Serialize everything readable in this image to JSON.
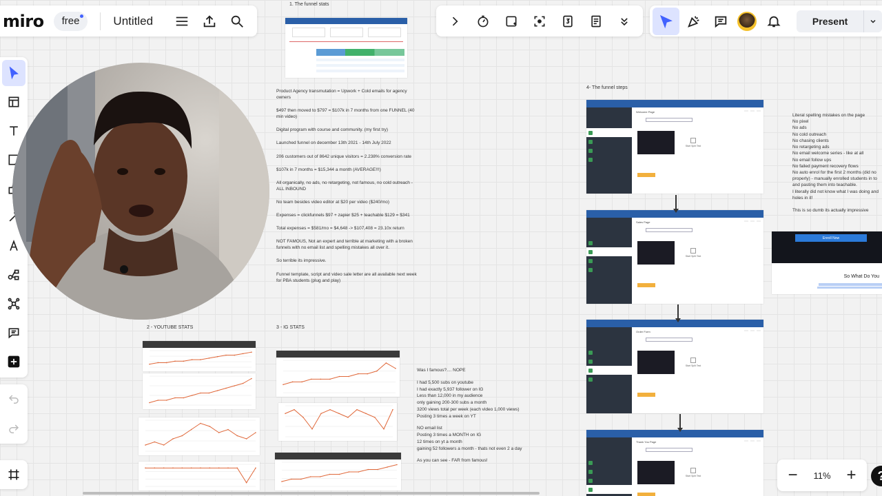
{
  "app": {
    "logo": "miro",
    "plan": "free",
    "board_title": "Untitled"
  },
  "topbar": {
    "present_label": "Present"
  },
  "zoom": {
    "level": "11%",
    "minus": "−",
    "plus": "+",
    "help": "?"
  },
  "sections": {
    "funnel_stats": "1. The funnel stats",
    "youtube_stats": "2 - YOUTUBE STATS",
    "ig_stats": "3 - IG STATS",
    "funnel_steps": "4- The funnel steps"
  },
  "notes": [
    "Product Agency transmutation = Upwork + Cold emails for agency owners",
    "$497 then moved to $797 = $107k in 7 months from one FUNNEL (40 min video)",
    "Digital program with course and community. (my first try)",
    "Launched funnel on december 13th 2021 - 14th July 2022",
    "206 customers out of 8642 unique visitors = 2.238% conversion rate",
    "$107k in 7 months = $15,344 a month (AVERAGE!!!)",
    "All organically, no ads, no retargeting, not famous, no cold outreach - ALL INBOUND",
    "No team besides video editor at $20 per video ($240/mo)",
    "Expenses = clickfunnels $97 + zapier $25 + teachable $129 = $341",
    "Total expenses = $581/mo = $4,648 -> $107,408 = 23.10x return",
    "NOT FAMOUS, Not an expert and terrible at marketing with a broken funnels with no email list and spelling mistakes all over it.",
    "So terrible its impressive.",
    "Funnel template, script and video sale letter are all available next week for PBA students (plug and play)"
  ],
  "fame_notes": {
    "intro": "Was I famous?.... NOPE",
    "youtube_lines": [
      "I had 5,500 subs on youtube",
      "I had exactly 5,937 follower on IG",
      "Less than 12,000 in my audience",
      "only gaining 200-300 subs a month",
      "3200 views total per week (each video 1,000 views)",
      "Posting 3 times a week on YT"
    ],
    "email_lines": [
      "NO email list",
      "Posting 3 times a MONTH on IG",
      "12 times on yt a month",
      "gaining 52 followers a month - thats not even 2 a day"
    ],
    "outro": "As you can see - FAR from famous!"
  },
  "mistakes": [
    "Literal spelling mistakes on the page",
    "No pixel",
    "No ads",
    "No cold outreach",
    "No chasing clients",
    "No retargeting ads",
    "No email welcome series - like at all",
    "No email follow ups",
    "No failed payment recovery flows",
    "No auto enrol for the first 2 months (did no",
    "properly) - manually enrolled students in to",
    "and pasting them into teachable.",
    "I literally did not know what I was doing and",
    "holes in it!",
    "",
    "This is so dumb its actually impressive"
  ],
  "webinar": {
    "enroll": "Enroll Now",
    "heading": "So What Do You"
  },
  "funnel_screens": [
    {
      "page": "Welcome Page",
      "start": "Start Split Test"
    },
    {
      "page": "Sales Page",
      "start": "Start Split Test"
    },
    {
      "page": "Order Form",
      "start": "Start Split Test"
    },
    {
      "page": "Thank You Page",
      "start": "Start Split Test"
    }
  ],
  "chart_data": [
    {
      "type": "line",
      "title": "",
      "series": [
        {
          "values": [
            2,
            3,
            3,
            4,
            4,
            5,
            5,
            6,
            7,
            8,
            8,
            9,
            10
          ]
        }
      ]
    },
    {
      "type": "line",
      "title": "",
      "series": [
        {
          "values": [
            1,
            2,
            2,
            3,
            3,
            4,
            5,
            5,
            6,
            7,
            8,
            9,
            11
          ]
        }
      ]
    },
    {
      "type": "line",
      "title": "",
      "series": [
        {
          "values": [
            2,
            3,
            2,
            4,
            5,
            7,
            9,
            8,
            6,
            7,
            5,
            4,
            6
          ]
        }
      ]
    },
    {
      "type": "line",
      "title": "",
      "series": [
        {
          "values": [
            5,
            5,
            5,
            5,
            5,
            5,
            5,
            5,
            5,
            5,
            5,
            1,
            5
          ]
        }
      ]
    },
    {
      "type": "line",
      "title": "",
      "series": [
        {
          "values": [
            3,
            4,
            4,
            5,
            5,
            5,
            6,
            6,
            7,
            7,
            8,
            11,
            9
          ]
        }
      ]
    },
    {
      "type": "line",
      "title": "",
      "series": [
        {
          "values": [
            6,
            7,
            5,
            2,
            6,
            7,
            6,
            5,
            7,
            6,
            5,
            2,
            7
          ]
        }
      ]
    },
    {
      "type": "line",
      "title": "",
      "series": [
        {
          "values": [
            2,
            3,
            3,
            4,
            4,
            5,
            5,
            6,
            6,
            7,
            7,
            8,
            9
          ]
        }
      ]
    }
  ]
}
